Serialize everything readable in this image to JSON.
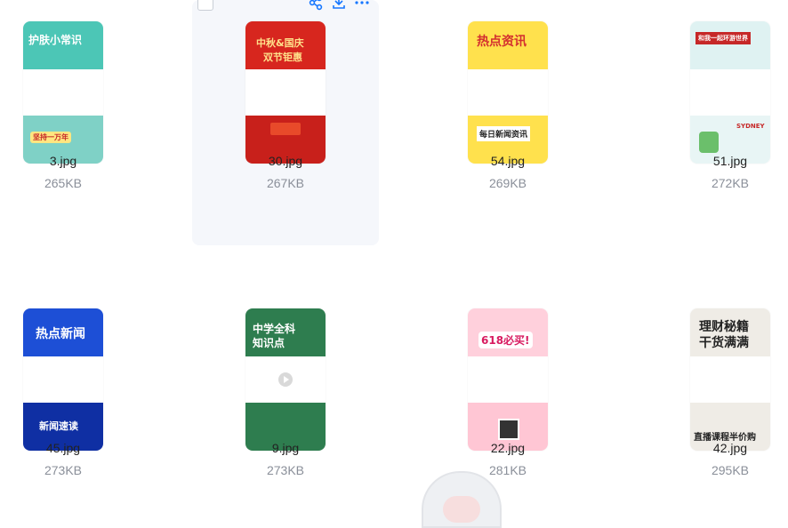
{
  "files": [
    {
      "name": "3.jpg",
      "size": "265KB",
      "top_text": "护肤小常识",
      "bot_text": "坚持一万年",
      "top_bg": "#4cc6b6",
      "bot_bg": "#7fd1c6"
    },
    {
      "name": "30.jpg",
      "size": "267KB",
      "top_text": "中秋&国庆",
      "top_text2": "双节钜惠",
      "bot_text": "",
      "top_bg": "#d7261e",
      "bot_bg": "#c8201b"
    },
    {
      "name": "54.jpg",
      "size": "269KB",
      "top_text": "热点资讯",
      "bot_text": "每日新闻资讯",
      "top_bg": "#ffe14d",
      "bot_bg": "#ffe14d"
    },
    {
      "name": "51.jpg",
      "size": "272KB",
      "top_text": "和我一起环游世界",
      "bot_text": "SYDNEY",
      "top_bg": "#dff2f2",
      "bot_bg": "#e8f5f5"
    },
    {
      "name": "45.jpg",
      "size": "273KB",
      "top_text": "热点新闻",
      "bot_text": "新闻速读",
      "top_bg": "#1d4fd6",
      "bot_bg": "#0f2fa3"
    },
    {
      "name": "9.jpg",
      "size": "273KB",
      "top_text": "中学全科",
      "top_text2": "知识点",
      "bot_text": "",
      "top_bg": "#2e7d4f",
      "bot_bg": "#2e7d4f"
    },
    {
      "name": "22.jpg",
      "size": "281KB",
      "top_text": "618必买!",
      "bot_text": "",
      "top_bg": "#ffd0dc",
      "bot_bg": "#ffc6d4"
    },
    {
      "name": "42.jpg",
      "size": "295KB",
      "top_text": "理财秘籍",
      "top_text2": "干货满满",
      "bot_text": "直播课程半价购",
      "top_bg": "#efece6",
      "bot_bg": "#efece6"
    }
  ],
  "toolbar": {
    "share_icon": "share-icon",
    "download_icon": "download-icon",
    "more_icon": "more-icon"
  },
  "colors": {
    "hover": "#f5f7fb",
    "accent": "#1677ff"
  }
}
